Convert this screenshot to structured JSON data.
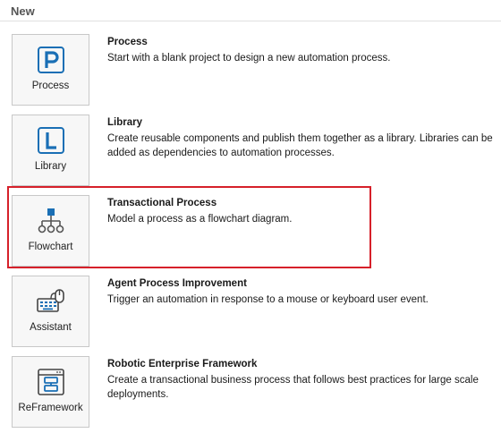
{
  "section_title": "New",
  "templates": [
    {
      "tile_label": "Process",
      "title": "Process",
      "description": "Start with a blank project to design a new automation process.",
      "icon": "process-icon"
    },
    {
      "tile_label": "Library",
      "title": "Library",
      "description": "Create reusable components and publish them together as a library. Libraries can be added as dependencies to automation processes.",
      "icon": "library-icon"
    },
    {
      "tile_label": "Flowchart",
      "title": "Transactional Process",
      "description": "Model a process as a flowchart diagram.",
      "icon": "flowchart-icon"
    },
    {
      "tile_label": "Assistant",
      "title": "Agent Process Improvement",
      "description": "Trigger an automation in response to a mouse or keyboard user event.",
      "icon": "assistant-icon"
    },
    {
      "tile_label": "ReFramework",
      "title": "Robotic Enterprise Framework",
      "description": "Create a transactional business process that follows best practices for large scale deployments.",
      "icon": "reframework-icon"
    }
  ],
  "colors": {
    "accent": "#1a6fb5",
    "highlight": "#d6202a"
  }
}
